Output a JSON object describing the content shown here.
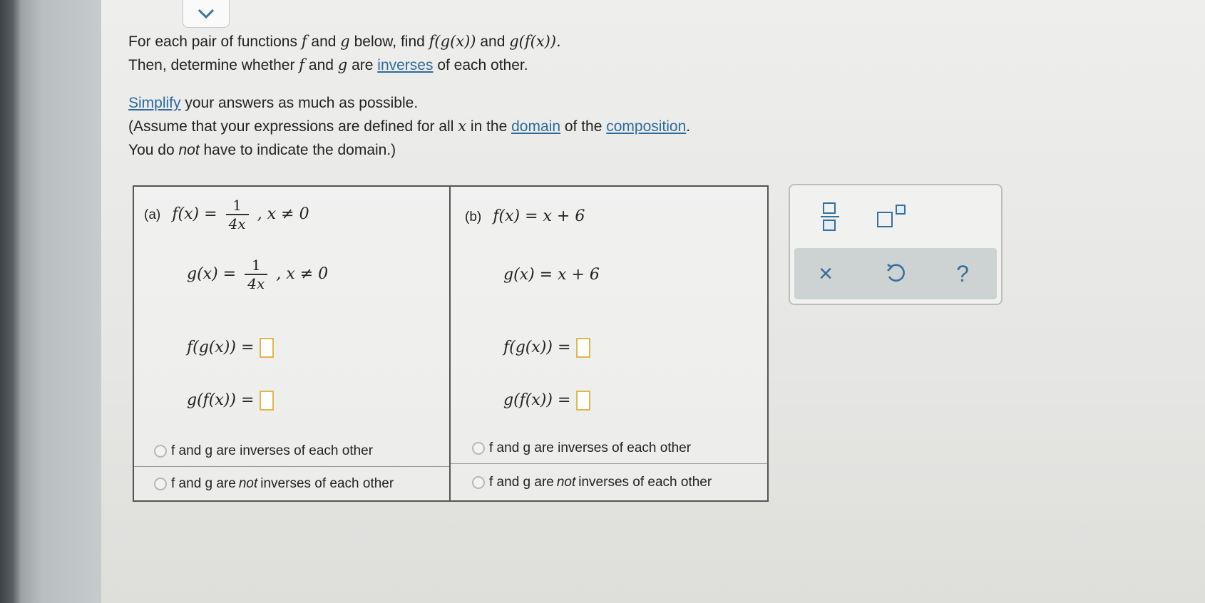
{
  "prompt": {
    "line1_a": "For each pair of functions ",
    "line1_f": "f",
    "line1_b": " and ",
    "line1_g": "g",
    "line1_c": " below, find ",
    "line1_fg": "f(g(x))",
    "line1_d": " and ",
    "line1_gf": "g(f(x)).",
    "line2_a": "Then, determine whether ",
    "line2_f": "f",
    "line2_b": " and ",
    "line2_g": "g",
    "line2_c": " are ",
    "line2_link": "inverses",
    "line2_d": " of each other.",
    "simplify_link": "Simplify",
    "line3_rest": " your answers as much as possible.",
    "line4_a": "(Assume that your expressions are defined for all ",
    "line4_x": "x",
    "line4_b": " in the ",
    "line4_domain_link": "domain",
    "line4_c": " of the ",
    "line4_composition_link": "composition",
    "line4_d": ".",
    "line5_a": "You do ",
    "line5_not": "not",
    "line5_b": " have to indicate the domain.)"
  },
  "part_a": {
    "label": "(a)",
    "f_lhs": "f(x) =",
    "f_num": "1",
    "f_den": "4x",
    "f_cond": ", x ≠ 0",
    "g_lhs": "g(x) =",
    "g_num": "1",
    "g_den": "4x",
    "g_cond": ", x ≠ 0",
    "fg_lhs": "f(g(x)) =",
    "gf_lhs": "g(f(x)) =",
    "option_inverse": "f and g are inverses of each other",
    "option_not_a": "f and g are ",
    "option_not_em": "not",
    "option_not_b": " inverses of each other"
  },
  "part_b": {
    "label": "(b)",
    "f_def": "f(x) = x + 6",
    "g_def": "g(x) = x + 6",
    "fg_lhs": "f(g(x)) =",
    "gf_lhs": "g(f(x)) =",
    "option_inverse": "f and g are inverses of each other",
    "option_not_a": "f and g are ",
    "option_not_em": "not",
    "option_not_b": " inverses of each other"
  },
  "toolbar": {
    "fraction_icon": "fraction-icon",
    "superscript_icon": "superscript-icon",
    "clear_symbol": "×",
    "undo_icon": "undo-icon",
    "help_symbol": "?"
  },
  "colors": {
    "link": "#2d6a9d",
    "answer_box": "#e2b64a",
    "toolbar_icon": "#3a6f9a"
  }
}
